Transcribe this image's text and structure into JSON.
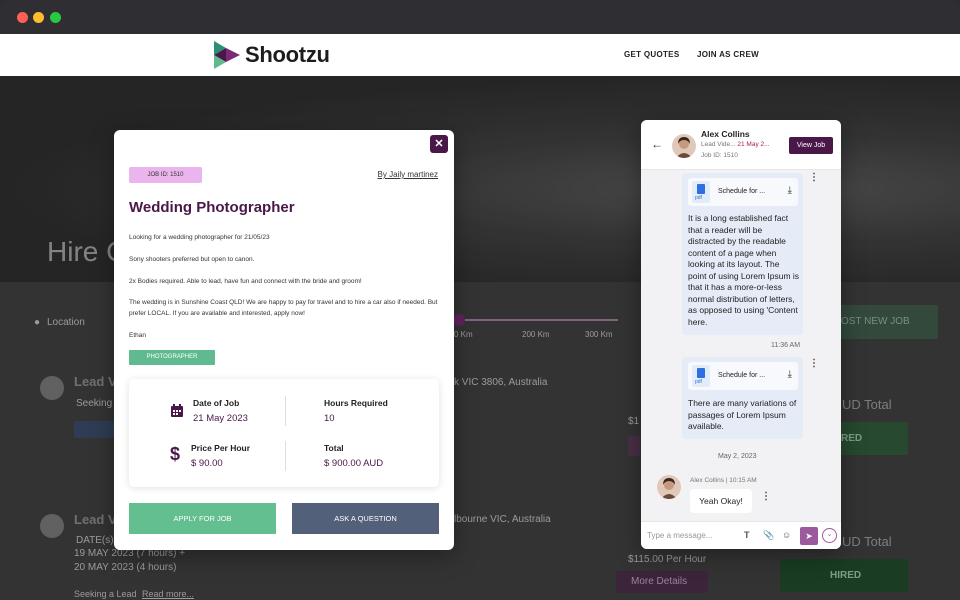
{
  "window": {
    "controls": [
      "close",
      "minimize",
      "maximize"
    ]
  },
  "header": {
    "logo_text": "Shootzu",
    "nav": [
      {
        "label": "GET QUOTES"
      },
      {
        "label": "JOIN AS CREW"
      }
    ]
  },
  "background": {
    "hero_title": "Hire C",
    "location_label": "Location",
    "km_ticks": [
      "0 Km",
      "200 Km",
      "300 Km"
    ],
    "post_job": "OST NEW JOB",
    "leads": [
      {
        "title": "Lead V",
        "location": "k VIC 3806, Australia",
        "teaser": "Seeking a",
        "price": "$1",
        "total": "UD Total",
        "status": "RED"
      },
      {
        "title": "Lead V",
        "location": "lbourne VIC, Australia",
        "dates_label": "DATE(s):",
        "date1": "19 MAY 2023 (7 hours) +",
        "date2": "20 MAY 2023 (4 hours)",
        "teaser": "Seeking a Lead",
        "read_more": "Read more...",
        "price": "$115.00 Per Hour",
        "more_details": "More Details",
        "total": "UD Total",
        "status": "HIRED"
      }
    ]
  },
  "job": {
    "id_badge": "JOB ID: 1510",
    "byline": "By Jaily martinez",
    "title": "Wedding Photographer",
    "description": [
      "Looking for a wedding photographer for 21/05/23",
      "Sony shooters preferred but open to canon.",
      "2x Bodies required. Able to lead, have fun and connect with the bride and groom!",
      "The wedding is in Sunshine Coast QLD!  We are happy to pay for travel and to hire a car also if needed. But prefer LOCAL. If you are available and interested, apply now!",
      "Ethan"
    ],
    "tag": "PHOTOGRAPHER",
    "date_label": "Date of Job",
    "date_value": "21 May 2023",
    "hours_label": "Hours Required",
    "hours_value": "10",
    "price_label": "Price Per Hour",
    "price_value": "$ 90.00",
    "total_label": "Total",
    "total_value": "$ 900.00 AUD",
    "apply_label": "APPLY FOR JOB",
    "ask_label": "ASK A QUESTION",
    "close_icon": "close-icon"
  },
  "chat": {
    "name": "Alex Collins",
    "role": "Lead Vide...",
    "role_date": "21 May 2...",
    "job_id": "Job ID: 1510",
    "view_job": "View Job",
    "messages": [
      {
        "file": "Schedule for ...",
        "file_type": "pdf",
        "text": "It is a long established fact that a reader will be distracted by the readable content of a page when looking at its layout. The point of using Lorem Ipsum is that it has a more-or-less normal distribution of letters, as opposed to using 'Content here.",
        "time": "11:36 AM"
      },
      {
        "file": "Schedule for ...",
        "file_type": "pdf",
        "text": "There are many variations of passages of Lorem Ipsum available."
      }
    ],
    "date_divider": "May 2, 2023",
    "reply": {
      "sender": "Alex Collins | 10:15 AM",
      "text": "Yeah Okay!"
    },
    "input_placeholder": "Type a message..."
  },
  "colors": {
    "brand_purple": "#4a1848",
    "green": "#63bf90",
    "slate": "#53607a",
    "badge_pink": "#e9b5ec"
  }
}
